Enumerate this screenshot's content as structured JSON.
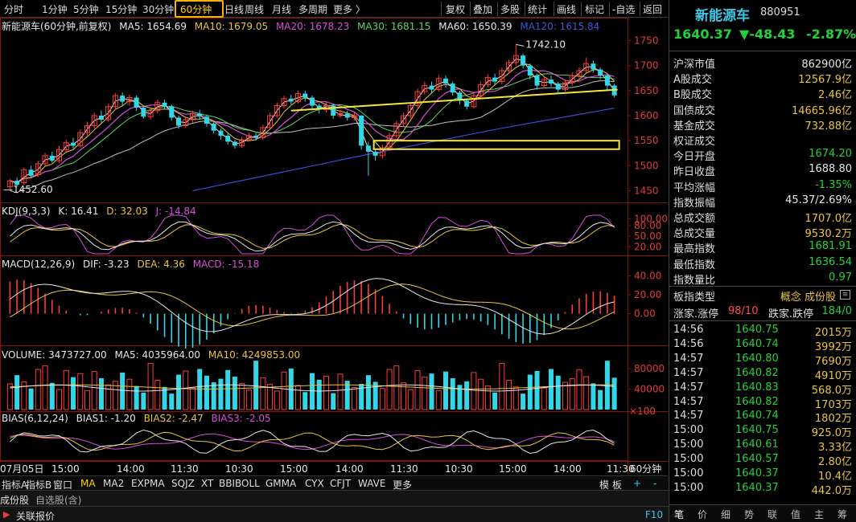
{
  "toolbar": {
    "periods": [
      "分时",
      "1分钟",
      "5分钟",
      "15分钟",
      "30分钟",
      "60分钟",
      "日线",
      "周线",
      "月线",
      "多周期",
      "更多 〉"
    ],
    "active_period": 5,
    "tools": [
      "复权",
      "叠加",
      "多股",
      "统计",
      "画线",
      "标记"
    ],
    "right": [
      "-自选",
      "返回"
    ]
  },
  "main_chart": {
    "legend": [
      {
        "text": "新能源车(60分钟,前复权)",
        "color": "#e6e6e6"
      },
      {
        "text": "MA5: 1654.69",
        "color": "#e6e6e6"
      },
      {
        "text": "MA10: 1679.05",
        "color": "#e8c53a"
      },
      {
        "text": "MA20: 1678.23",
        "color": "#d94cd9"
      },
      {
        "text": "MA30: 1681.15",
        "color": "#5ad45a"
      },
      {
        "text": "MA60: 1650.39",
        "color": "#e6e6e6"
      },
      {
        "text": "MA120: 1615.84",
        "color": "#3a5ad4"
      }
    ],
    "high_label": "1742.10",
    "low_label": "1452.60",
    "y_ticks": [
      "1750",
      "1700",
      "1650",
      "1600",
      "1550",
      "1500",
      "1450"
    ]
  },
  "kdj": {
    "legend": [
      {
        "text": "KDJ(9,3,3)",
        "color": "#e6e6e6"
      },
      {
        "text": "K: 16.41",
        "color": "#e6e6e6"
      },
      {
        "text": "D: 32.03",
        "color": "#e8c53a"
      },
      {
        "text": "J: -14.84",
        "color": "#d94cd9"
      }
    ],
    "y_ticks": [
      "100.00",
      "80.00",
      "50.00",
      "20.00"
    ]
  },
  "macd": {
    "legend": [
      {
        "text": "MACD(12,26,9)",
        "color": "#e6e6e6"
      },
      {
        "text": "DIF: -3.23",
        "color": "#e6e6e6"
      },
      {
        "text": "DEA: 4.36",
        "color": "#e8c53a"
      },
      {
        "text": "MACD: -15.18",
        "color": "#d94cd9"
      }
    ],
    "y_ticks": [
      "40.00",
      "20.00",
      "0.00"
    ]
  },
  "volume": {
    "legend": [
      {
        "text": "VOLUME: 3473727.00",
        "color": "#e6e6e6"
      },
      {
        "text": "MA5: 4035964.00",
        "color": "#e6e6e6"
      },
      {
        "text": "MA10: 4249853.00",
        "color": "#e8c53a"
      }
    ],
    "y_ticks": [
      "80000",
      "40000"
    ],
    "unit": "×100"
  },
  "bias": {
    "legend": [
      {
        "text": "BIAS(6,12,24)",
        "color": "#e6e6e6"
      },
      {
        "text": "BIAS1: -1.20",
        "color": "#e6e6e6"
      },
      {
        "text": "BIAS2: -2.47",
        "color": "#e8c53a"
      },
      {
        "text": "BIAS3: -2.05",
        "color": "#d94cd9"
      }
    ]
  },
  "x_axis": {
    "labels": [
      "07月05日",
      "15:00",
      "14:00",
      "11:30",
      "10:30",
      "15:00",
      "14:00",
      "11:30",
      "10:30",
      "15:00",
      "14:00",
      "11:30"
    ],
    "period_label": "60分钟"
  },
  "indicator_tabs": [
    "指标A",
    "指标B",
    "窗口",
    "MA",
    "MA2",
    "EXPMA",
    "SQJZ",
    "XT",
    "BBIBOLL",
    "GMMA",
    "CYX",
    "CFJT",
    "WAVE",
    "更多"
  ],
  "indicator_active": 3,
  "indicator_right": [
    "模 板",
    "+",
    "-"
  ],
  "status1": {
    "a": "成份股",
    "b": "自选股(含)"
  },
  "status2": {
    "a": "关联报价",
    "b": "F10"
  },
  "right_panel": {
    "name": "新能源车",
    "code": "880951",
    "price": "1640.37",
    "change": "▼-48.43",
    "pct": "-2.87%",
    "stats": [
      {
        "k": "沪深市值",
        "v": "862900亿",
        "c": "w"
      },
      {
        "k": "A股成交",
        "v": "12567.9亿",
        "c": "y"
      },
      {
        "k": "B股成交",
        "v": "2.46亿",
        "c": "y"
      },
      {
        "k": "国债成交",
        "v": "14665.96亿",
        "c": "y"
      },
      {
        "k": "基金成交",
        "v": "732.88亿",
        "c": "y"
      },
      {
        "k": "权证成交",
        "v": "",
        "c": "y"
      },
      {
        "k": "今日开盘",
        "v": "1674.20",
        "c": "g"
      },
      {
        "k": "昨日收盘",
        "v": "1688.80",
        "c": "w"
      },
      {
        "k": "平均涨幅",
        "v": "-1.35%",
        "c": "g"
      },
      {
        "k": "指数振幅",
        "v": "45.37/2.69%",
        "c": "w"
      },
      {
        "k": "总成交额",
        "v": "1707.0亿",
        "c": "y"
      },
      {
        "k": "总成交量",
        "v": "9530.2万",
        "c": "y"
      },
      {
        "k": "最高指数",
        "v": "1681.91",
        "c": "g"
      },
      {
        "k": "最低指数",
        "v": "1636.54",
        "c": "g"
      },
      {
        "k": "指数量比",
        "v": "0.97",
        "c": "g"
      }
    ],
    "board_type": {
      "k": "板指类型",
      "v": "概念 成份股"
    },
    "limit": {
      "k1": "涨家.涨停",
      "v1": "98/10",
      "k2": "跌家.跌停",
      "v2": "184/0"
    },
    "ticks": [
      {
        "t": "14:56",
        "p": "1640.75",
        "v": "2015万"
      },
      {
        "t": "14:56",
        "p": "1640.74",
        "v": "3992万"
      },
      {
        "t": "14:57",
        "p": "1640.80",
        "v": "7690万"
      },
      {
        "t": "14:57",
        "p": "1640.82",
        "v": "4910万"
      },
      {
        "t": "14:57",
        "p": "1640.83",
        "v": "568.0万"
      },
      {
        "t": "14:57",
        "p": "1640.82",
        "v": "1703万"
      },
      {
        "t": "14:57",
        "p": "1640.74",
        "v": "1802万"
      },
      {
        "t": "15:00",
        "p": "1640.75",
        "v": "925.0万"
      },
      {
        "t": "15:00",
        "p": "1640.61",
        "v": "3.33亿"
      },
      {
        "t": "15:00",
        "p": "1640.57",
        "v": "2.80亿"
      },
      {
        "t": "15:00",
        "p": "1640.37",
        "v": "10.4亿"
      },
      {
        "t": "15:00",
        "p": "1640.37",
        "v": "442.0万"
      }
    ],
    "tabs": [
      "笔",
      "价",
      "细",
      "势",
      "联",
      "值",
      "主",
      "筹"
    ]
  },
  "chart_data": {
    "type": "candlestick",
    "candles": [
      [
        1458,
        1470,
        1474,
        1452.6
      ],
      [
        1470,
        1462,
        1476,
        1458
      ],
      [
        1466,
        1492,
        1496,
        1462
      ],
      [
        1492,
        1480,
        1500,
        1476
      ],
      [
        1482,
        1504,
        1510,
        1478
      ],
      [
        1504,
        1520,
        1526,
        1500
      ],
      [
        1520,
        1510,
        1528,
        1506
      ],
      [
        1510,
        1532,
        1540,
        1506
      ],
      [
        1532,
        1546,
        1552,
        1528
      ],
      [
        1546,
        1540,
        1556,
        1534
      ],
      [
        1540,
        1566,
        1572,
        1536
      ],
      [
        1566,
        1580,
        1588,
        1560
      ],
      [
        1580,
        1600,
        1606,
        1574
      ],
      [
        1600,
        1592,
        1610,
        1586
      ],
      [
        1592,
        1618,
        1624,
        1588
      ],
      [
        1618,
        1640,
        1645,
        1612
      ],
      [
        1640,
        1628,
        1646,
        1620
      ],
      [
        1628,
        1636,
        1642,
        1620
      ],
      [
        1636,
        1616,
        1640,
        1610
      ],
      [
        1616,
        1598,
        1620,
        1594
      ],
      [
        1598,
        1610,
        1616,
        1592
      ],
      [
        1610,
        1626,
        1632,
        1604
      ],
      [
        1626,
        1618,
        1632,
        1612
      ],
      [
        1618,
        1596,
        1622,
        1590
      ],
      [
        1596,
        1580,
        1600,
        1574
      ],
      [
        1580,
        1592,
        1598,
        1576
      ],
      [
        1592,
        1604,
        1610,
        1586
      ],
      [
        1604,
        1598,
        1612,
        1592
      ],
      [
        1598,
        1584,
        1602,
        1578
      ],
      [
        1584,
        1570,
        1588,
        1564
      ],
      [
        1570,
        1560,
        1574,
        1552
      ],
      [
        1560,
        1548,
        1564,
        1542
      ],
      [
        1548,
        1540,
        1552,
        1534
      ],
      [
        1540,
        1552,
        1558,
        1536
      ],
      [
        1552,
        1560,
        1566,
        1548
      ],
      [
        1560,
        1556,
        1566,
        1550
      ],
      [
        1556,
        1576,
        1582,
        1552
      ],
      [
        1576,
        1600,
        1606,
        1572
      ],
      [
        1600,
        1620,
        1626,
        1596
      ],
      [
        1620,
        1634,
        1640,
        1614
      ],
      [
        1634,
        1628,
        1642,
        1622
      ],
      [
        1628,
        1644,
        1650,
        1624
      ],
      [
        1644,
        1636,
        1650,
        1628
      ],
      [
        1636,
        1620,
        1640,
        1614
      ],
      [
        1620,
        1612,
        1624,
        1604
      ],
      [
        1612,
        1620,
        1628,
        1606
      ],
      [
        1620,
        1600,
        1624,
        1594
      ],
      [
        1600,
        1604,
        1612,
        1596
      ],
      [
        1604,
        1596,
        1610,
        1590
      ],
      [
        1596,
        1600,
        1606,
        1590
      ],
      [
        1600,
        1540,
        1602,
        1532
      ],
      [
        1540,
        1528,
        1548,
        1480
      ],
      [
        1528,
        1520,
        1534,
        1510
      ],
      [
        1520,
        1536,
        1542,
        1514
      ],
      [
        1536,
        1560,
        1566,
        1532
      ],
      [
        1560,
        1584,
        1590,
        1556
      ],
      [
        1584,
        1600,
        1606,
        1578
      ],
      [
        1600,
        1620,
        1626,
        1594
      ],
      [
        1620,
        1648,
        1654,
        1616
      ],
      [
        1648,
        1660,
        1668,
        1642
      ],
      [
        1660,
        1652,
        1668,
        1644
      ],
      [
        1652,
        1674,
        1680,
        1648
      ],
      [
        1674,
        1664,
        1680,
        1656
      ],
      [
        1664,
        1646,
        1668,
        1640
      ],
      [
        1646,
        1630,
        1650,
        1622
      ],
      [
        1630,
        1618,
        1634,
        1612
      ],
      [
        1618,
        1640,
        1646,
        1614
      ],
      [
        1640,
        1662,
        1668,
        1636
      ],
      [
        1662,
        1676,
        1682,
        1656
      ],
      [
        1676,
        1668,
        1684,
        1660
      ],
      [
        1668,
        1690,
        1696,
        1662
      ],
      [
        1690,
        1706,
        1712,
        1684
      ],
      [
        1706,
        1720,
        1742.1,
        1700
      ],
      [
        1720,
        1700,
        1724,
        1694
      ],
      [
        1700,
        1680,
        1704,
        1672
      ],
      [
        1680,
        1660,
        1684,
        1652
      ],
      [
        1660,
        1672,
        1678,
        1654
      ],
      [
        1672,
        1664,
        1680,
        1658
      ],
      [
        1664,
        1652,
        1668,
        1646
      ],
      [
        1652,
        1666,
        1672,
        1648
      ],
      [
        1666,
        1680,
        1686,
        1660
      ],
      [
        1680,
        1690,
        1696,
        1674
      ],
      [
        1690,
        1704,
        1716,
        1686
      ],
      [
        1704,
        1692,
        1710,
        1686
      ],
      [
        1692,
        1680,
        1696,
        1672
      ],
      [
        1680,
        1660,
        1684,
        1652
      ],
      [
        1660,
        1640.37,
        1664,
        1636.5
      ]
    ],
    "ylim": [
      1430,
      1770
    ]
  }
}
